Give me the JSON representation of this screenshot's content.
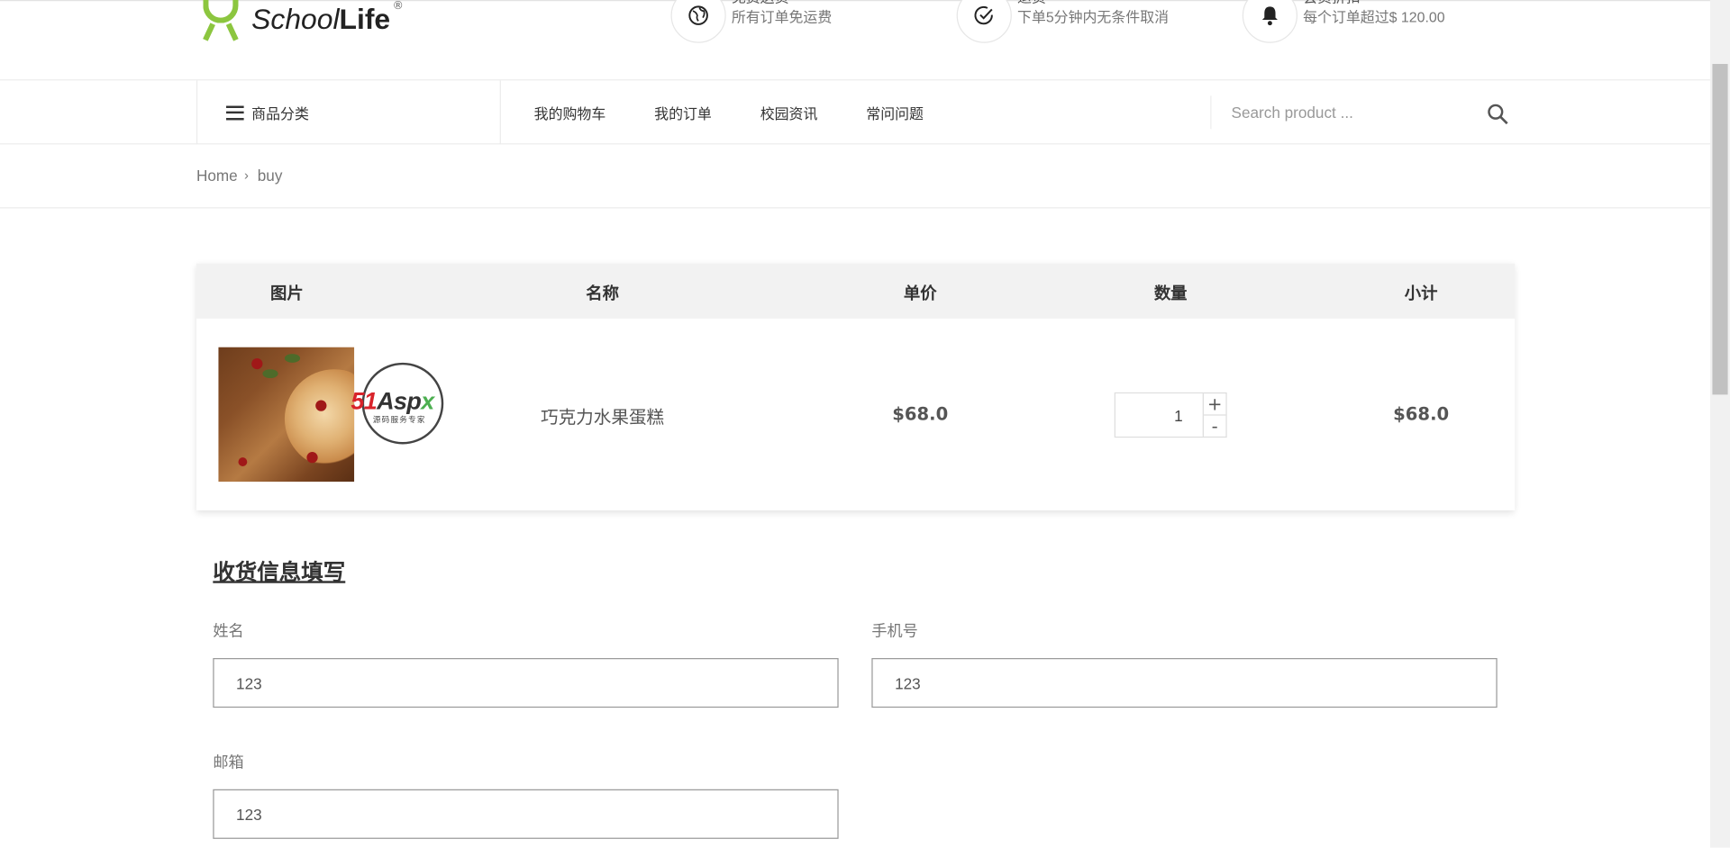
{
  "logo": {
    "text_main": "School",
    "text_bold": "Life",
    "reg": "®"
  },
  "features": [
    {
      "icon": "globe-icon",
      "title": "免费送货",
      "subtitle": "所有订单免运费"
    },
    {
      "icon": "check-circle-icon",
      "title": "退货",
      "subtitle": "下单5分钟内无条件取消"
    },
    {
      "icon": "bell-icon",
      "title": "会员折扣",
      "subtitle": "每个订单超过$ 120.00"
    }
  ],
  "nav": {
    "category_label": "商品分类",
    "links": [
      "我的购物车",
      "我的订单",
      "校园资讯",
      "常问问题"
    ],
    "search_placeholder": "Search product ..."
  },
  "breadcrumb": {
    "home": "Home",
    "sep": "›",
    "current": "buy"
  },
  "cart": {
    "headers": [
      "图片",
      "名称",
      "单价",
      "数量",
      "小计"
    ],
    "item": {
      "name": "巧克力水果蛋糕",
      "price": "$68.0",
      "qty": "1",
      "subtotal": "$68.0",
      "plus": "+",
      "minus": "-"
    },
    "watermark": {
      "p1": "51",
      "p2": "A",
      "p3": "sp",
      "p4": "x",
      "sub": "源码服务专家"
    }
  },
  "form": {
    "title": "收货信息填写",
    "name_label": "姓名",
    "name_value": "123",
    "phone_label": "手机号",
    "phone_value": "123",
    "email_label": "邮箱",
    "email_value": "123"
  }
}
